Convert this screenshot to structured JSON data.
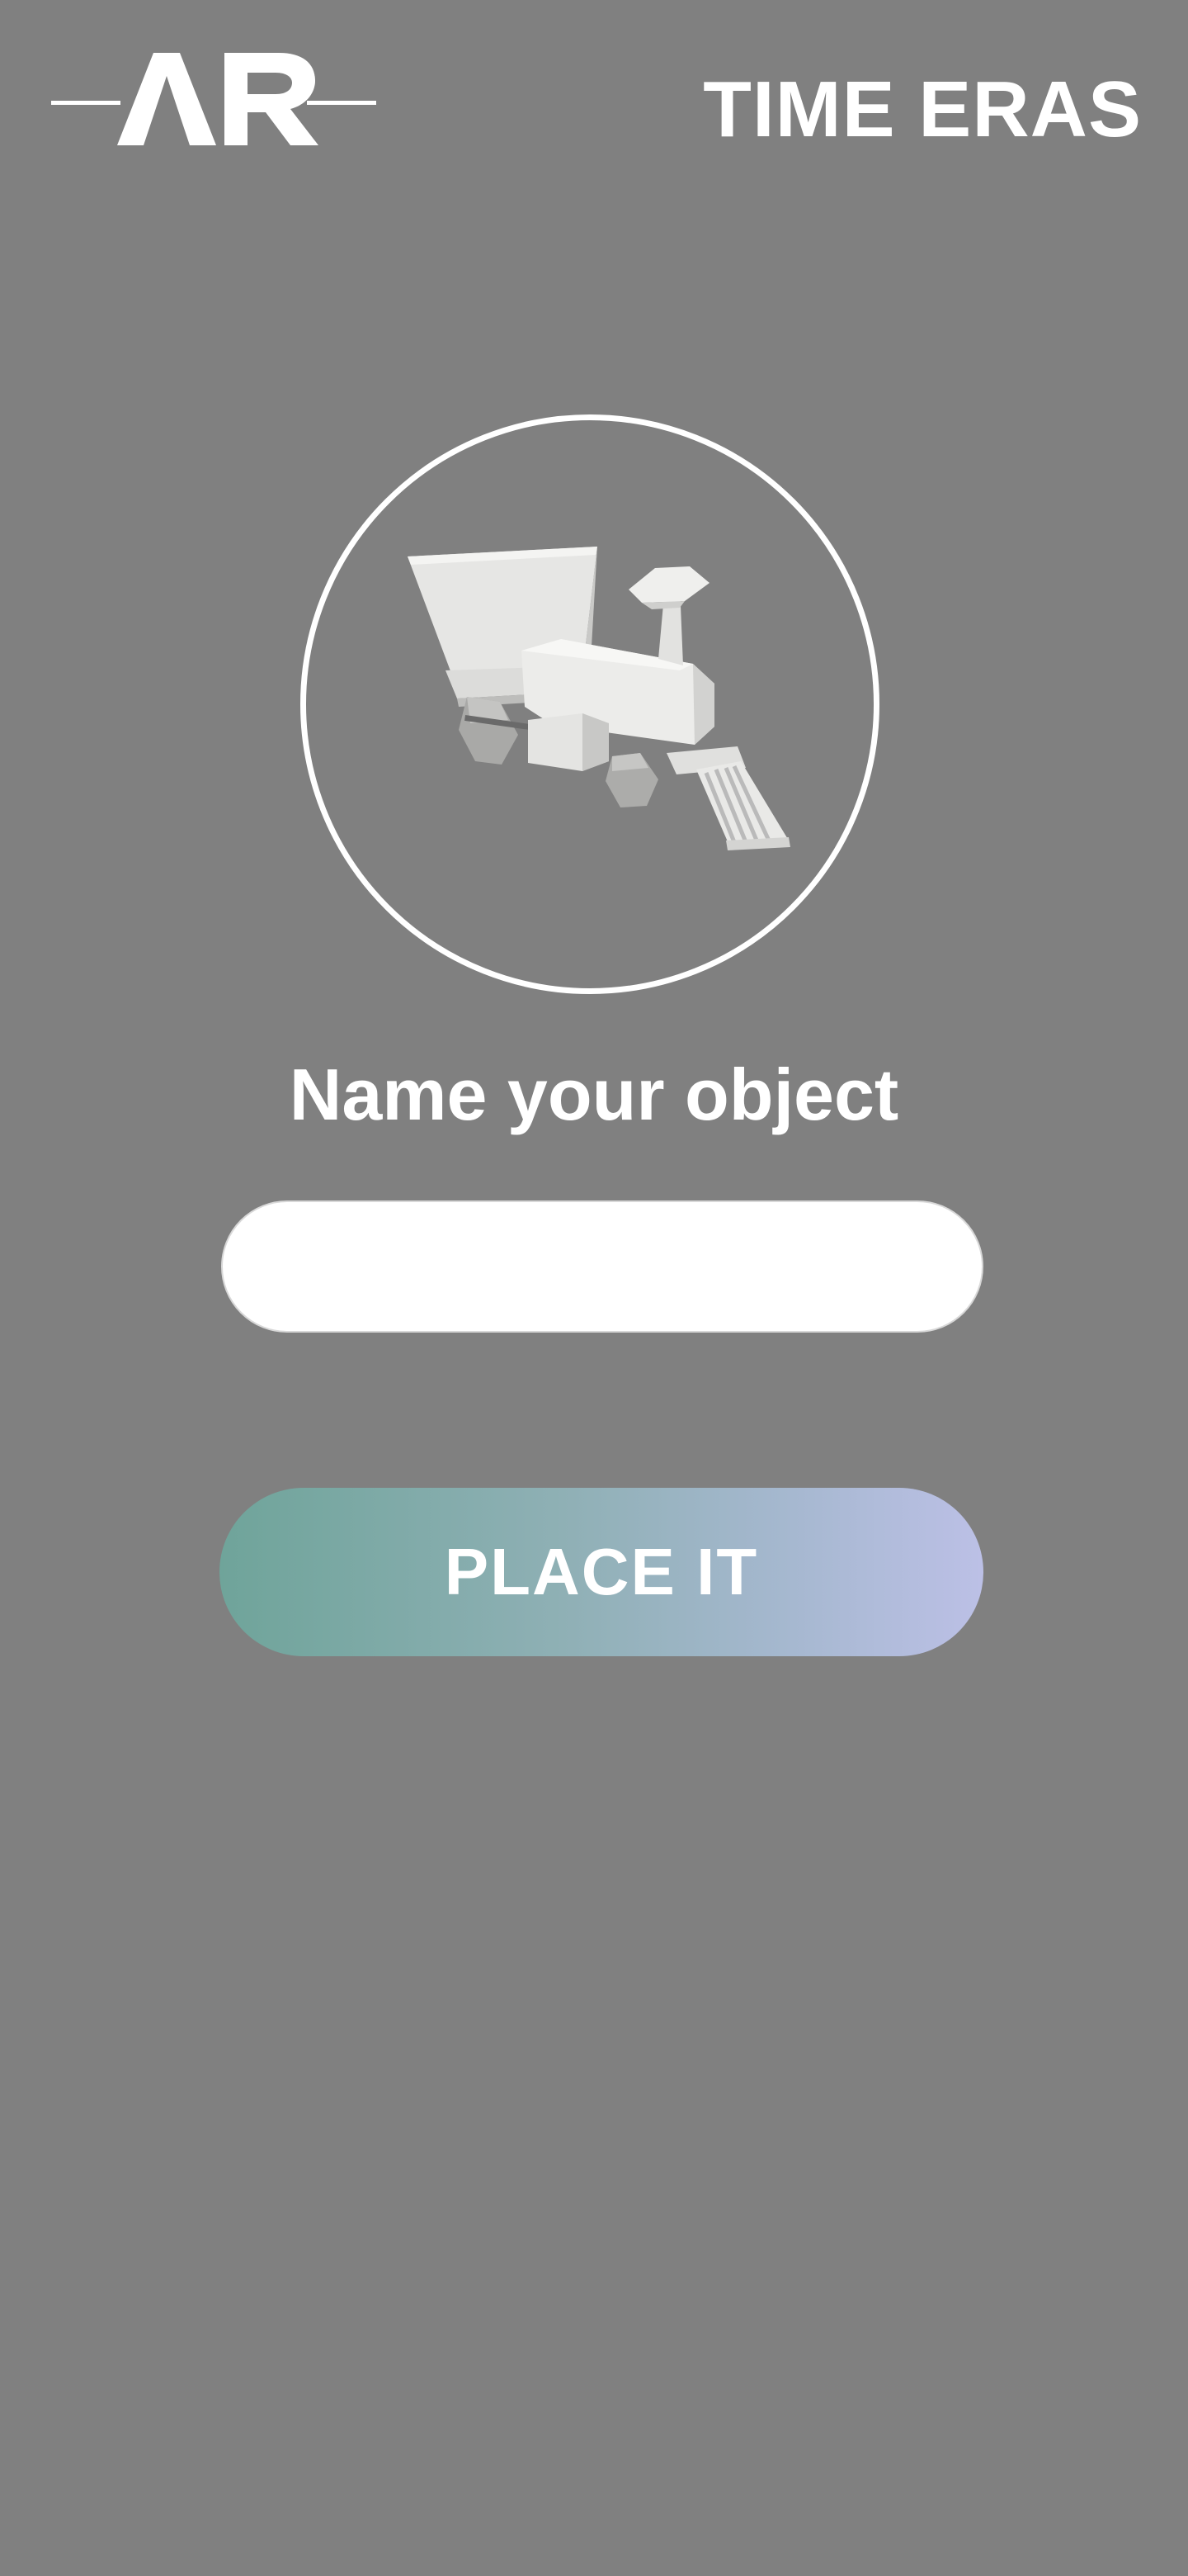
{
  "header": {
    "logo_text": "AR",
    "title": "TIME ERAS"
  },
  "preview": {
    "object_icon": "steam-locomotive-3d-model"
  },
  "form": {
    "prompt": "Name your object",
    "name_value": "",
    "name_placeholder": "",
    "place_button_label": "PLACE IT"
  },
  "colors": {
    "background": "#808080",
    "gradient_start": "#6fa49a",
    "gradient_end": "#bcc0e6"
  }
}
